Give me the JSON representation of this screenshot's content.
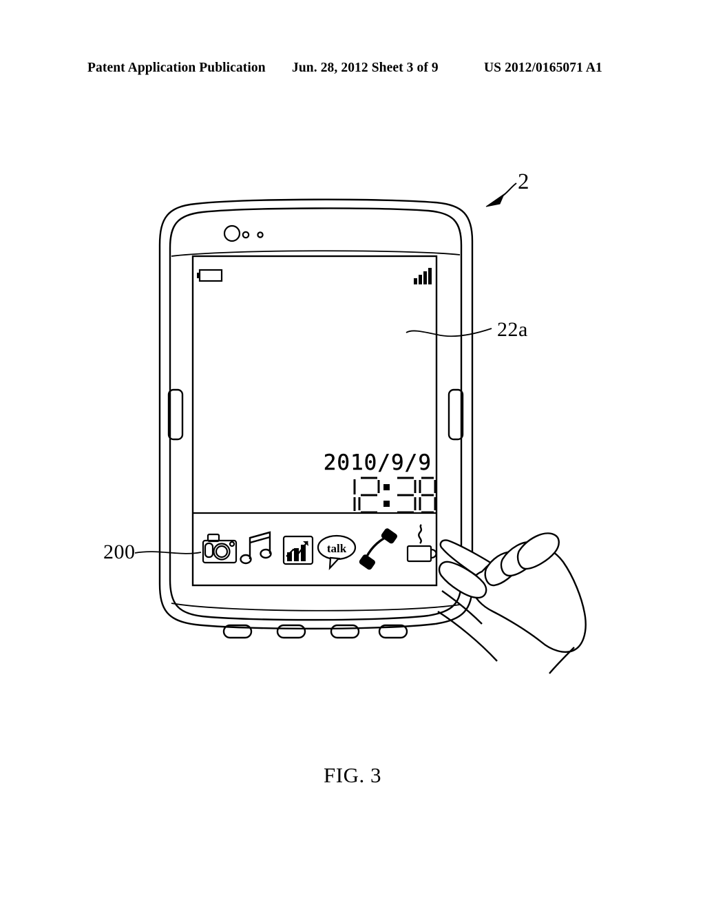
{
  "header": {
    "left": "Patent Application Publication",
    "center": "Jun. 28, 2012  Sheet 3 of 9",
    "right": "US 2012/0165071 A1"
  },
  "figure": {
    "caption": "FIG. 3",
    "reference_labels": [
      {
        "id": "device",
        "text": "2"
      },
      {
        "id": "display-area",
        "text": "22a"
      },
      {
        "id": "dock-bar",
        "text": "200"
      }
    ]
  },
  "device": {
    "name": "handheld-electronic-device",
    "front_camera": "camera-lens-hole",
    "sensors": [
      "sensor-dot-large",
      "sensor-dot-small"
    ],
    "side_buttons": [
      "left-side-button",
      "right-side-button"
    ],
    "bottom_buttons": [
      "button-1",
      "button-2",
      "button-3",
      "button-4"
    ]
  },
  "screen": {
    "status_bar": {
      "battery_icon": "battery-icon",
      "signal_icon": "signal-bars-icon",
      "signal_bars": 4
    },
    "clock": {
      "date": "2010/9/9",
      "time": "12:38",
      "style": "seven-segment"
    },
    "dock": {
      "label": "200",
      "items": [
        {
          "name": "camera-icon",
          "label": "Camera"
        },
        {
          "name": "music-icon",
          "label": "Music"
        },
        {
          "name": "chart-icon",
          "label": "Chart"
        },
        {
          "name": "talk-icon",
          "label": "talk"
        },
        {
          "name": "phone-icon",
          "label": "Phone"
        },
        {
          "name": "coffee-icon",
          "label": "Coffee"
        }
      ]
    }
  },
  "hand": {
    "name": "touching-hand",
    "gesture": "index-finger-touch"
  },
  "colors": {
    "ink": "#000000",
    "paper": "#ffffff"
  }
}
